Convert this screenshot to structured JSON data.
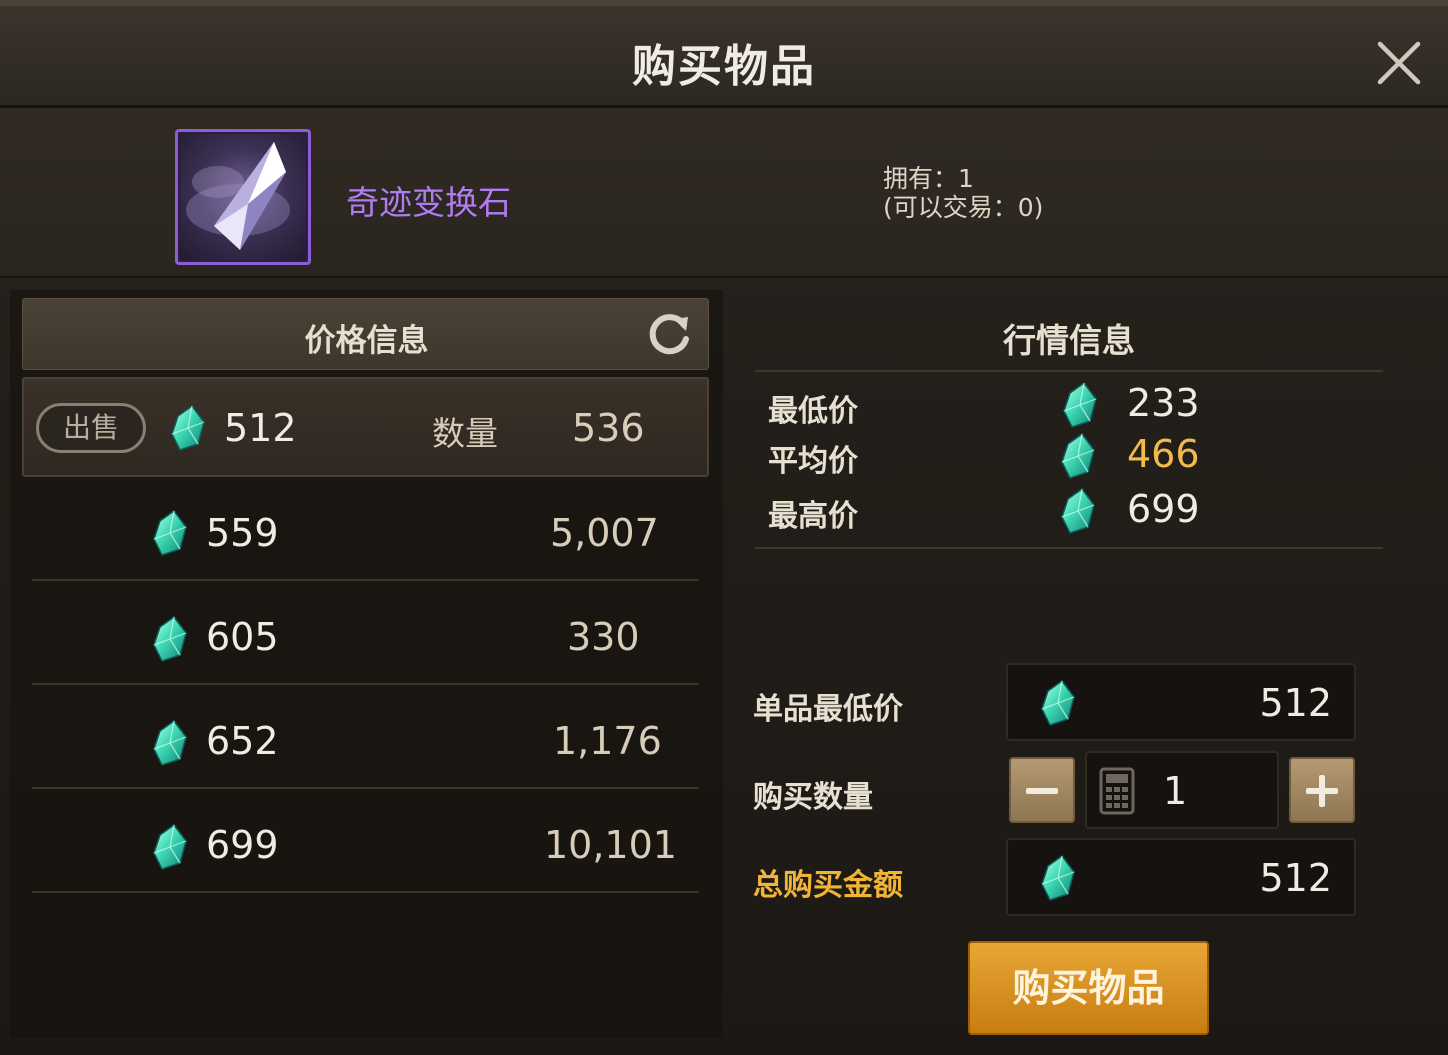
{
  "window": {
    "title": "购买物品"
  },
  "item": {
    "name": "奇迹变换石",
    "owned": "拥有：1",
    "tradable": "(可以交易：0)"
  },
  "price_panel": {
    "header": "价格信息",
    "sell_label": "出售",
    "quantity_label": "数量",
    "rows": [
      {
        "price": "512",
        "quantity": "536"
      },
      {
        "price": "559",
        "quantity": "5,007"
      },
      {
        "price": "605",
        "quantity": "330"
      },
      {
        "price": "652",
        "quantity": "1,176"
      },
      {
        "price": "699",
        "quantity": "10,101"
      }
    ]
  },
  "market": {
    "header": "行情信息",
    "min_label": "最低价",
    "min_value": "233",
    "avg_label": "平均价",
    "avg_value": "466",
    "max_label": "最高价",
    "max_value": "699"
  },
  "purchase": {
    "unit_min_label": "单品最低价",
    "unit_min_value": "512",
    "quantity_label": "购买数量",
    "quantity_value": "1",
    "total_label": "总购买金额",
    "total_value": "512",
    "buy_button": "购买物品"
  },
  "colors": {
    "accent_gold": "#f2b436",
    "item_purple": "#b07cf2",
    "button": "#d98f1f"
  },
  "icons": [
    "close-icon",
    "refresh-icon",
    "gem-icon",
    "calculator-icon",
    "minus-icon",
    "plus-icon"
  ]
}
